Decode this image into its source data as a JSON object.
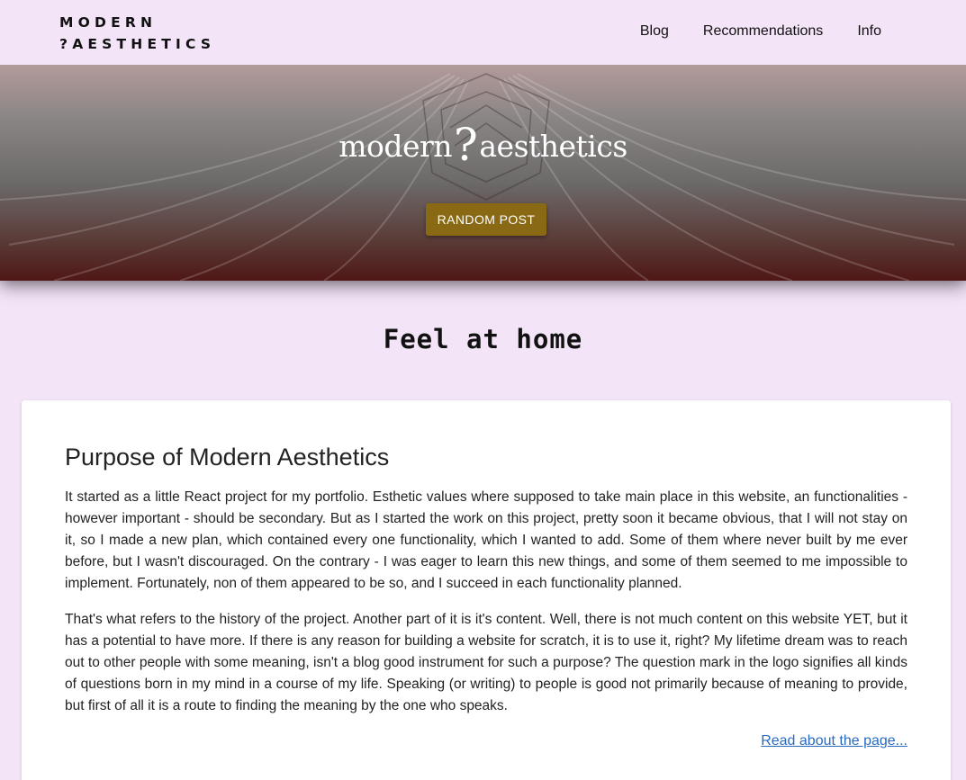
{
  "header": {
    "logo_line1": "MODERN",
    "logo_line2": "?AESTHETICS",
    "nav": [
      {
        "label": "Blog"
      },
      {
        "label": "Recommendations"
      },
      {
        "label": "Info"
      }
    ]
  },
  "hero": {
    "title_left": "modern",
    "title_mark": "?",
    "title_right": "aesthetics",
    "button_label": "RANDOM POST",
    "button_color": "#8a6914"
  },
  "tagline": "Feel at home",
  "card": {
    "heading": "Purpose of Modern Aesthetics",
    "paragraph1": "It started as a little React project for my portfolio. Esthetic values where supposed to take main place in this website, an functionalities - however important - should be secondary. But as I started the work on this project, pretty soon it became obvious, that I will not stay on it, so I made a new plan, which contained every one functionality, which I wanted to add. Some of them where never built by me ever before, but I wasn't discouraged. On the contrary - I was eager to learn this new things, and some of them seemed to me impossible to implement. Fortunately, non of them appeared to be so, and I succeed in each functionality planned.",
    "paragraph2": "That's what refers to the history of the project. Another part of it is it's content. Well, there is not much content on this website YET, but it has a potential to have more. If there is any reason for building a website for scratch, it is to use it, right? My lifetime dream was to reach out to other people with some meaning, isn't a blog good instrument for such a purpose? The question mark in the logo signifies all kinds of questions born in my mind in a course of my life. Speaking (or writing) to people is good not primarily because of meaning to provide, but first of all it is a route to finding the meaning by the one who speaks.",
    "link_label": "Read about the page..."
  },
  "colors": {
    "page_background": "#f3e4f7",
    "link": "#2a6bbf",
    "hero_bottom": "#4f1716"
  }
}
